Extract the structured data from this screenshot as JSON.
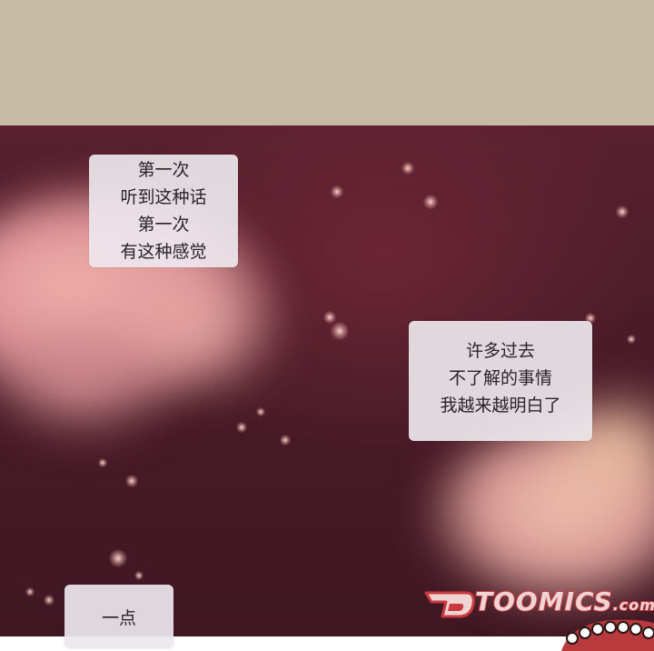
{
  "panel": {
    "background_top": "#c8bba3",
    "background_scene": "#4b1b29"
  },
  "bubbles": [
    {
      "lines": [
        "第一次",
        "听到这种话",
        "第一次",
        "有这种感觉"
      ]
    },
    {
      "lines": [
        "许多过去",
        "不了解的事情",
        "我越来越明白了"
      ]
    },
    {
      "lines": [
        "一点"
      ]
    }
  ],
  "watermark": {
    "name": "TOOMICS",
    "suffix": ".com",
    "icon": "toomics-logo-icon",
    "color": "#c83a3e"
  }
}
